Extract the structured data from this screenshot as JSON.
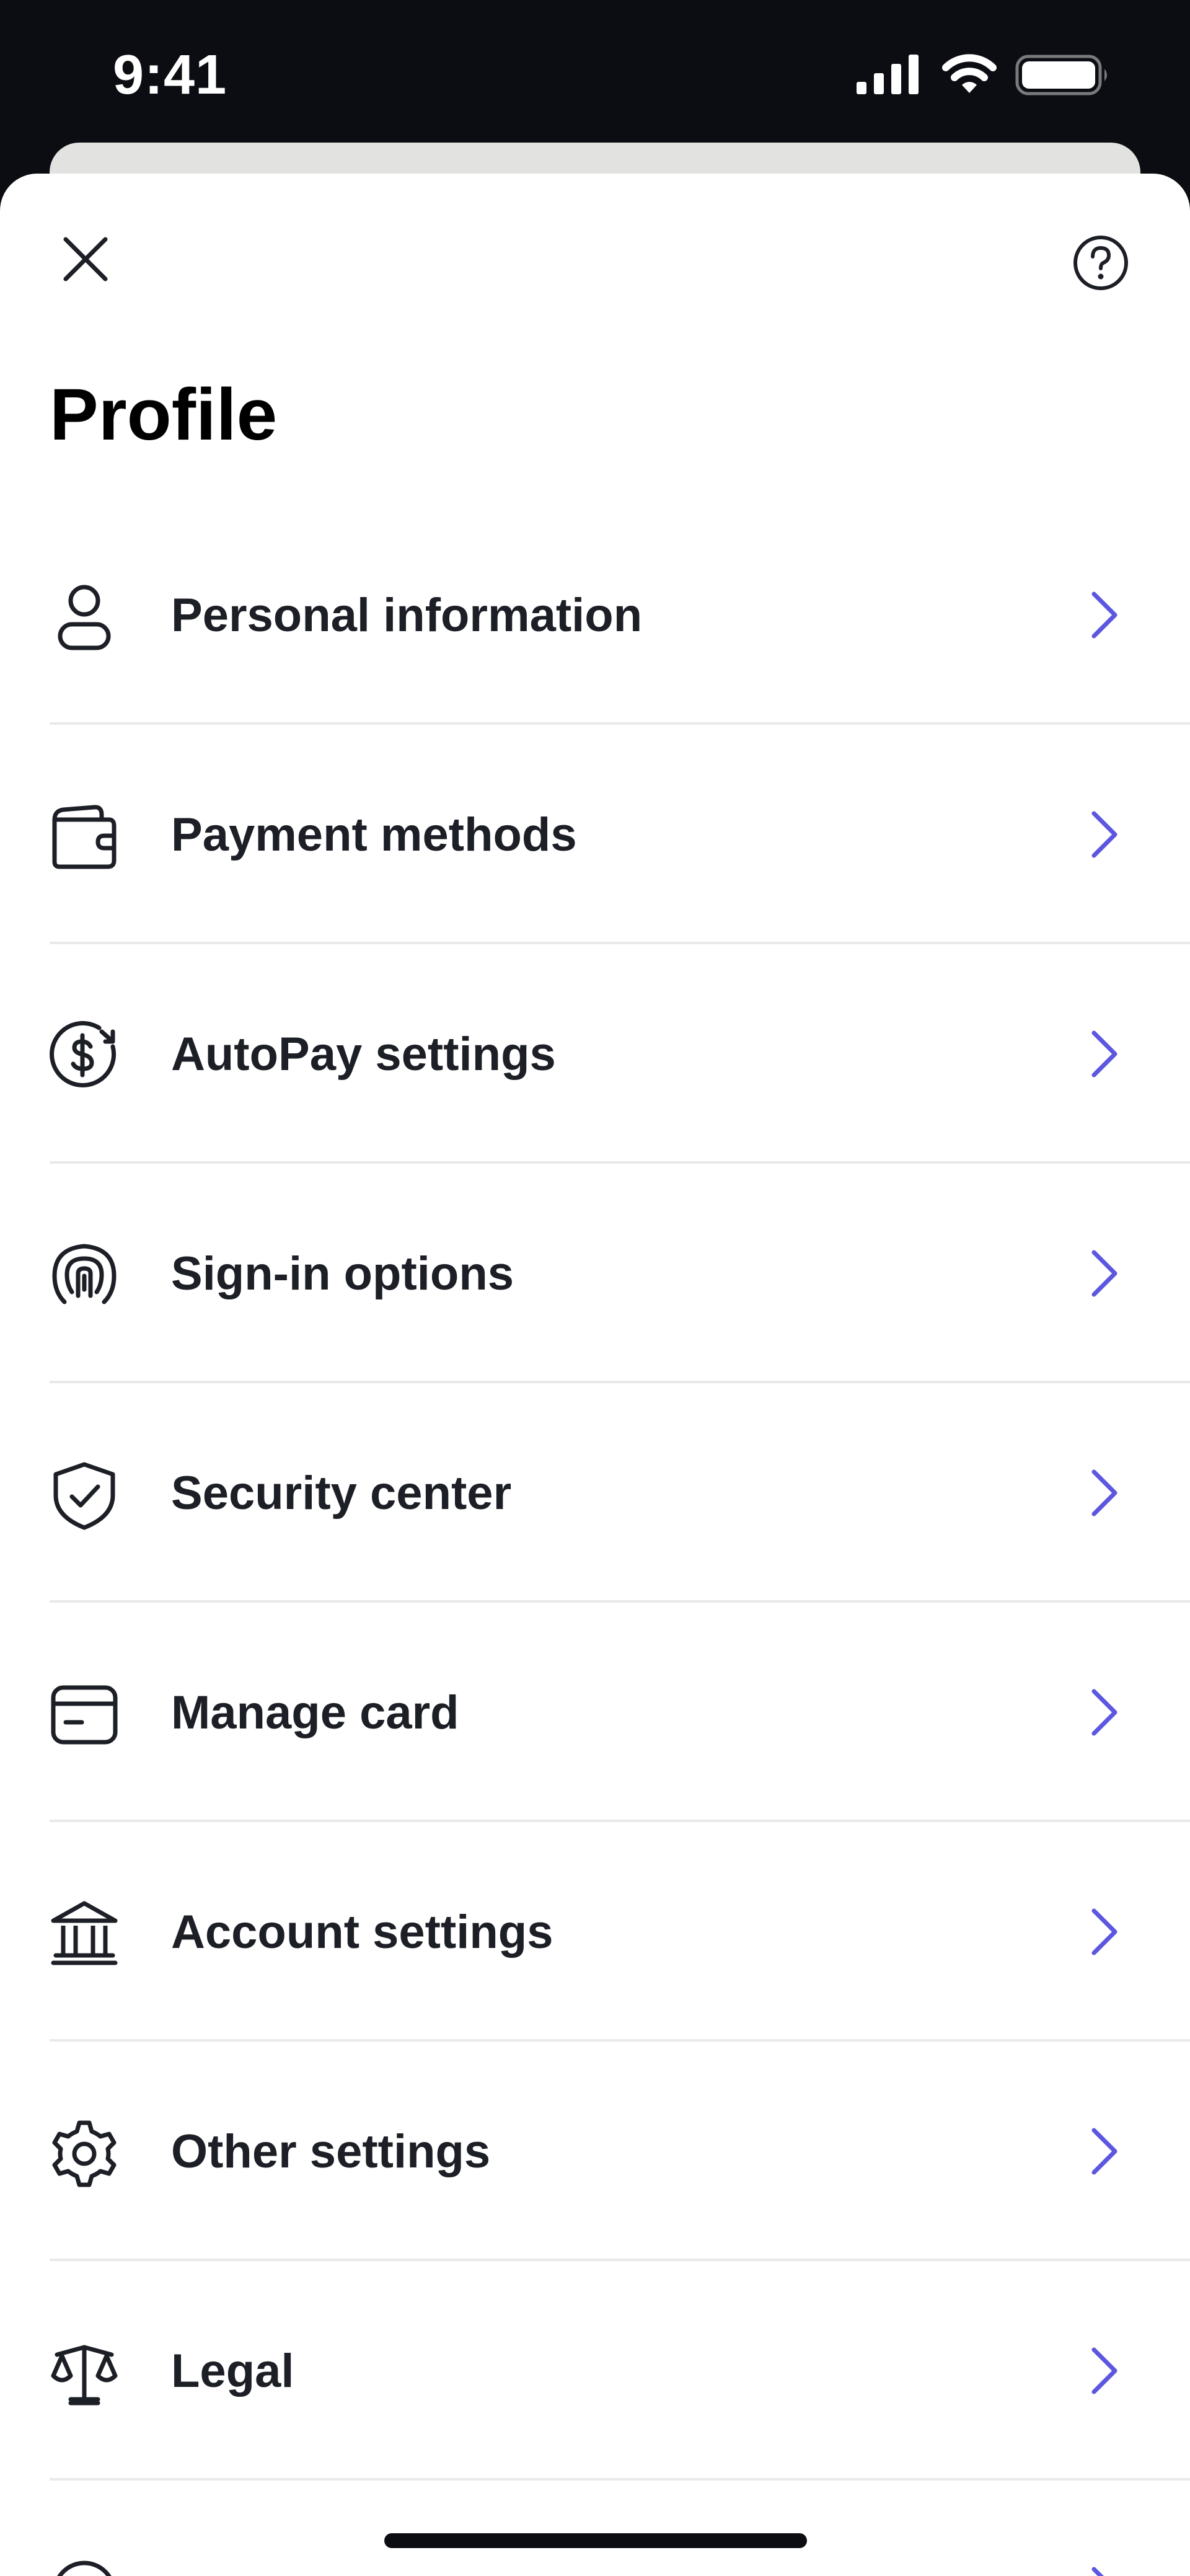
{
  "status_bar": {
    "time": "9:41",
    "icons": [
      "cellular-signal-icon",
      "wifi-icon",
      "battery-icon"
    ]
  },
  "header": {
    "close_icon": "close-icon",
    "help_icon": "help-icon",
    "title": "Profile"
  },
  "menu": {
    "items": [
      {
        "label": "Personal information",
        "icon": "person-icon"
      },
      {
        "label": "Payment methods",
        "icon": "wallet-icon"
      },
      {
        "label": "AutoPay settings",
        "icon": "autopay-icon"
      },
      {
        "label": "Sign-in options",
        "icon": "fingerprint-icon"
      },
      {
        "label": "Security center",
        "icon": "shield-check-icon"
      },
      {
        "label": "Manage card",
        "icon": "card-icon"
      },
      {
        "label": "Account settings",
        "icon": "bank-icon"
      },
      {
        "label": "Other settings",
        "icon": "gear-icon"
      },
      {
        "label": "Legal",
        "icon": "scales-icon"
      },
      {
        "label": "",
        "icon": "circle-icon"
      }
    ],
    "chevron_icon": "chevron-right-icon"
  },
  "colors": {
    "status_bar_bg": "#0b0d12",
    "sheet_bg": "#ffffff",
    "text": "#1d1f26",
    "icon_stroke": "#1d1f26",
    "chevron": "#5b57e0",
    "divider": "#e8e9e8",
    "peek_card": "#e2e3e1"
  }
}
